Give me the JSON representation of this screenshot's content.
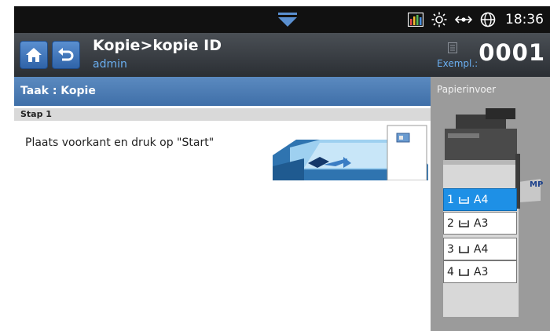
{
  "statusbar": {
    "time": "18:36",
    "icons": [
      "pull-down-tab-icon",
      "equalizer-icon",
      "brightness-icon",
      "network-icon",
      "globe-icon"
    ]
  },
  "header": {
    "title": "Kopie>kopie ID",
    "user": "admin",
    "copies_label": "Exempl.:",
    "copies_value": "0001",
    "home_icon": "home-icon",
    "back_icon": "back-arrow-icon"
  },
  "task": {
    "label": "Taak : Kopie",
    "step": "Stap 1",
    "instruction": "Plaats voorkant en druk op \"Start\""
  },
  "paper_panel": {
    "title": "Papierinvoer",
    "mp_label": "MP",
    "selected_tray": 1,
    "trays": [
      {
        "number": "1",
        "size": "A4"
      },
      {
        "number": "2",
        "size": "A3"
      },
      {
        "number": "3",
        "size": "A4"
      },
      {
        "number": "4",
        "size": "A3"
      }
    ]
  },
  "colors": {
    "titlebar": "#3a3f45",
    "taskbar": "#4d7db6",
    "accent_text": "#6aaef0",
    "selected_tray": "#1e90e6",
    "panel": "#9b9b9b"
  }
}
